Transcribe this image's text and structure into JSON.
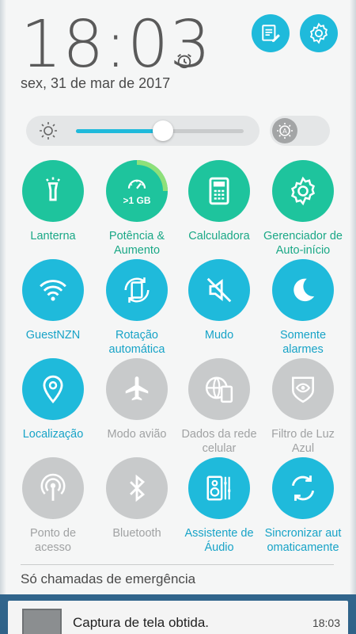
{
  "header": {
    "time": "18:03",
    "date": "sex, 31 de mar de 2017",
    "edit_button_icon": "note-edit-icon",
    "settings_button_icon": "gear-icon"
  },
  "brightness": {
    "level_fraction": 0.52,
    "auto_icon": "auto-brightness-icon"
  },
  "colors": {
    "accent_blue": "#1fbadb",
    "accent_green": "#1ec49d",
    "inactive_gray": "#c8cacb"
  },
  "tiles": [
    {
      "label": "Lanterna",
      "icon": "flashlight-icon",
      "state": "green"
    },
    {
      "label": "Potência &\nAumento",
      "icon": "speedometer-icon",
      "badge": ">1 GB",
      "state": "green"
    },
    {
      "label": "Calculadora",
      "icon": "calculator-icon",
      "state": "green"
    },
    {
      "label": "Gerenciador de\nAuto-início",
      "icon": "gear-icon",
      "state": "green"
    },
    {
      "label": "GuestNZN",
      "icon": "wifi-icon",
      "state": "blue"
    },
    {
      "label": "Rotação\nautomática",
      "icon": "rotate-icon",
      "state": "blue"
    },
    {
      "label": "Mudo",
      "icon": "mute-icon",
      "state": "blue"
    },
    {
      "label": "Somente\nalarmes",
      "icon": "moon-icon",
      "state": "blue"
    },
    {
      "label": "Localização",
      "icon": "location-icon",
      "state": "blue"
    },
    {
      "label": "Modo avião",
      "icon": "airplane-icon",
      "state": "gray"
    },
    {
      "label": "Dados da rede\ncelular",
      "icon": "mobile-data-icon",
      "state": "gray"
    },
    {
      "label": "Filtro de Luz\nAzul",
      "icon": "eye-filter-icon",
      "state": "gray"
    },
    {
      "label": "Ponto de\nacesso",
      "icon": "hotspot-icon",
      "state": "gray"
    },
    {
      "label": "Bluetooth",
      "icon": "bluetooth-icon",
      "state": "gray"
    },
    {
      "label": "Assistente de\nÁudio",
      "icon": "speaker-icon",
      "state": "blue"
    },
    {
      "label": "Sincronizar aut\nomaticamente",
      "icon": "sync-icon",
      "state": "blue"
    }
  ],
  "footer": {
    "emergency": "Só chamadas de emergência"
  },
  "notification": {
    "title": "Captura de tela obtida.",
    "time": "18:03"
  }
}
